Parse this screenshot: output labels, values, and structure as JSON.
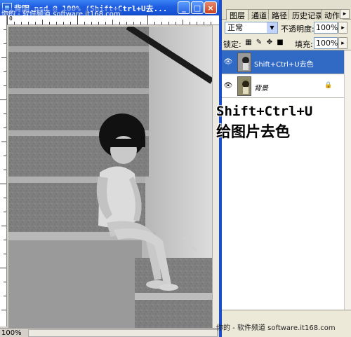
{
  "document": {
    "title": "背阴.psd @ 100% (Shift+Ctrl+U去...",
    "watermark_top": "你的 - 软件频道 software.it168.com",
    "buttons": {
      "minimize": "_",
      "maximize": "□",
      "close": "×"
    },
    "zoom": "100%"
  },
  "panel": {
    "tabs": [
      {
        "label": "图层"
      },
      {
        "label": "通道"
      },
      {
        "label": "路径"
      },
      {
        "label": "历史记录"
      },
      {
        "label": "动作"
      }
    ],
    "blend_mode": "正常",
    "opacity_label": "不透明度:",
    "opacity_value": "100%",
    "lock_label": "锁定:",
    "fill_label": "填充:",
    "fill_value": "100%",
    "layers": [
      {
        "name": "Shift+Ctrl+U去色",
        "selected": true,
        "icon": "eye-icon"
      },
      {
        "name": "背景",
        "selected": false,
        "icon": "eye-icon",
        "lock_icon": "lock-icon"
      }
    ],
    "footer_watermark": "你的 - 软件频道 software.it168.com"
  },
  "annotation": {
    "line1": "Shift+Ctrl+U",
    "line2": "给图片去色"
  },
  "colors": {
    "titlebar": "#1f5ee2",
    "selected_layer": "#316ac5",
    "panel_bg": "#ece9d8"
  }
}
